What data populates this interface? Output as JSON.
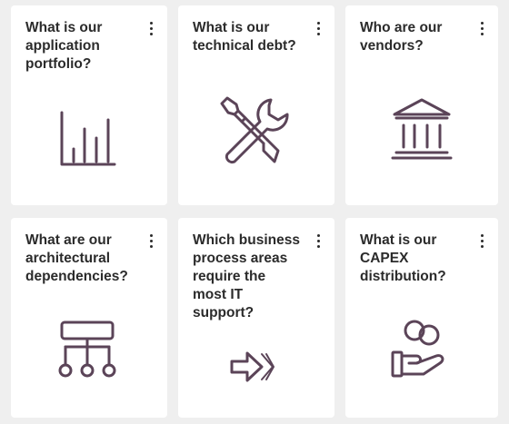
{
  "cards": [
    {
      "title": "What is our\napplication\nportfolio?",
      "icon": "bar-chart-icon",
      "menu": "more-options"
    },
    {
      "title": "What is our\ntechnical debt?",
      "icon": "wrench-screwdriver-icon",
      "menu": "more-options"
    },
    {
      "title": "Who are our\nvendors?",
      "icon": "bank-building-icon",
      "menu": "more-options"
    },
    {
      "title": "What are our\narchitectural\ndependencies?",
      "icon": "hierarchy-icon",
      "menu": "more-options"
    },
    {
      "title": "Which business\nprocess areas\nrequire the\nmost IT\nsupport?",
      "icon": "process-arrow-icon",
      "menu": "more-options"
    },
    {
      "title": "What is our\nCAPEX\ndistribution?",
      "icon": "hand-coins-icon",
      "menu": "more-options"
    }
  ],
  "colors": {
    "background": "#efefef",
    "card": "#ffffff",
    "text": "#2b2b2b",
    "icon": "#5b4458"
  }
}
